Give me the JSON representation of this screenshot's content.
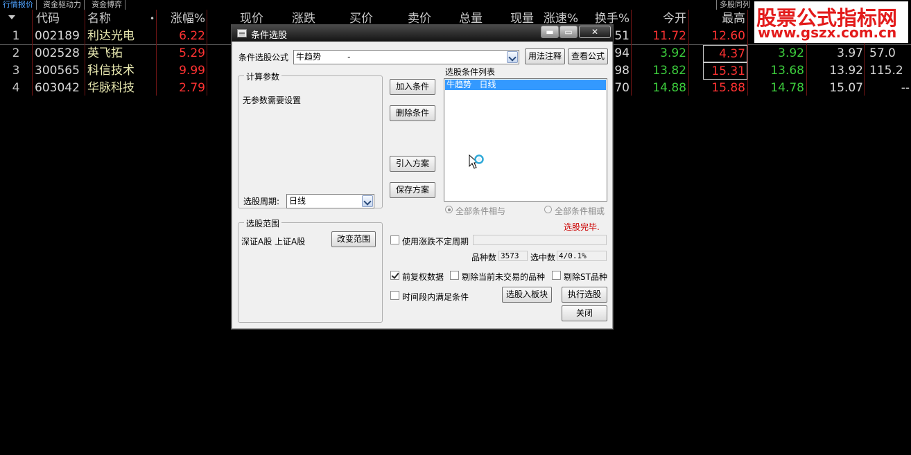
{
  "tabs": [
    "行情报价",
    "资金驱动力",
    "资金博弈"
  ],
  "tab_right": "多股同列",
  "logo": {
    "line1": "股票公式指标网",
    "line2": "www.gszx.com.cn"
  },
  "table": {
    "headers": {
      "code": "代码",
      "name": "名称",
      "name_dot": "•",
      "change_pct": "涨幅%",
      "price": "现价",
      "change": "涨跌",
      "bid": "买价",
      "ask": "卖价",
      "volume": "总量",
      "cur_vol": "现量",
      "speed": "涨速%",
      "turnover": "换手%",
      "open": "今开",
      "high": "最高"
    },
    "rows": [
      {
        "idx": "1",
        "code": "002189",
        "name": "利达光电",
        "change_pct": "6.22",
        "turnover": "51",
        "open": "11.72",
        "high": "12.60",
        "c3": "",
        "c4": "",
        "c5": ""
      },
      {
        "idx": "2",
        "code": "002528",
        "name": "英飞拓",
        "change_pct": "5.29",
        "turnover": "94",
        "open": "3.92",
        "high": "4.37",
        "c3": "3.92",
        "c4": "3.97",
        "c5": "57.0"
      },
      {
        "idx": "3",
        "code": "300565",
        "name": "科信技术",
        "change_pct": "9.99",
        "turnover": "98",
        "open": "13.82",
        "high": "15.31",
        "c3": "13.68",
        "c4": "13.92",
        "c5": "115.2"
      },
      {
        "idx": "4",
        "code": "603042",
        "name": "华脉科技",
        "change_pct": "2.79",
        "turnover": "70",
        "open": "14.88",
        "high": "15.88",
        "c3": "14.78",
        "c4": "15.07",
        "c5": "--"
      }
    ]
  },
  "dialog": {
    "title": "条件选股",
    "win_buttons": {
      "minimize": "▬",
      "maximize": "▭",
      "close": "✕"
    },
    "formula_label": "条件选股公式",
    "formula_value": "牛趋势          -",
    "usage_btn": "用法注释",
    "view_formula_btn": "查看公式",
    "params_group": "计算参数",
    "params_text": "无参数需要设置",
    "period_label": "选股周期:",
    "period_value": "日线",
    "add_cond_btn": "加入条件",
    "del_cond_btn": "删除条件",
    "import_btn": "引入方案",
    "save_btn": "保存方案",
    "cond_list_label": "选股条件列表",
    "cond_list": [
      "牛趋势   日线"
    ],
    "radio_and": "全部条件相与",
    "radio_or": "全部条件相或",
    "status": "选股完毕.",
    "range_group": "选股范围",
    "range_text": "深证A股 上证A股",
    "change_range_btn": "改变范围",
    "use_period_label": "使用涨跌不定周期",
    "count_label": "品种数",
    "count_value": "3573",
    "selected_label": "选中数",
    "selected_value": "4/0.1%",
    "adj_label": "前复权数据",
    "excl_untraded_label": "剔除当前未交易的品种",
    "excl_st_label": "剔除ST品种",
    "time_range_label": "时间段内满足条件",
    "to_block_btn": "选股入板块",
    "run_btn": "执行选股",
    "close_btn": "关闭"
  }
}
